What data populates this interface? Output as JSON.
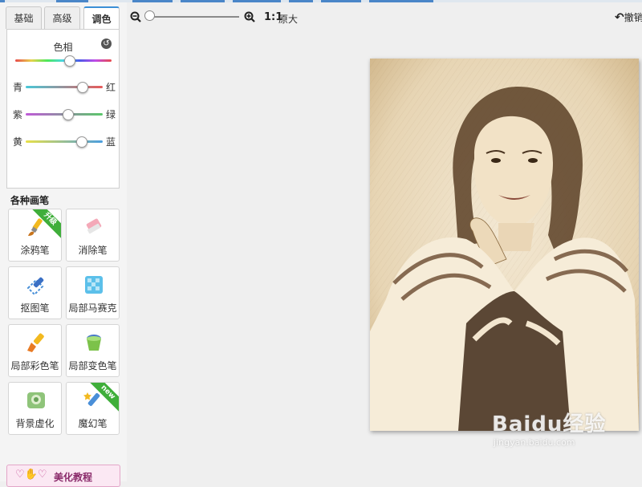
{
  "tabs": [
    {
      "label": "基础"
    },
    {
      "label": "高级"
    },
    {
      "label": "调色",
      "active": true
    }
  ],
  "color_panel": {
    "hue_label": "色相",
    "hue_level": 0.56,
    "sliders": [
      {
        "left": "青",
        "right": "红",
        "level": 0.73
      },
      {
        "left": "紫",
        "right": "绿",
        "level": 0.54
      },
      {
        "left": "黄",
        "right": "蓝",
        "level": 0.72
      }
    ]
  },
  "brushes": {
    "title": "各种画笔",
    "items": [
      {
        "label": "涂鸦笔",
        "icon": "paintbrush-icon",
        "badge": "升级"
      },
      {
        "label": "消除笔",
        "icon": "eraser-icon"
      },
      {
        "label": "抠图笔",
        "icon": "cutout-pen-icon"
      },
      {
        "label": "局部马赛克",
        "icon": "mosaic-icon"
      },
      {
        "label": "局部彩色笔",
        "icon": "color-brush-icon"
      },
      {
        "label": "局部变色笔",
        "icon": "paint-bucket-icon"
      },
      {
        "label": "背景虚化",
        "icon": "blur-background-icon"
      },
      {
        "label": "魔幻笔",
        "icon": "magic-pen-icon",
        "badge": "new"
      }
    ]
  },
  "tutorial": {
    "label": "美化教程"
  },
  "zoom": {
    "level": 0.0,
    "ratio_label": "1:1",
    "original_label": "原大"
  },
  "undo": {
    "label": "撤销"
  },
  "watermark": {
    "brand": "Baidu经验",
    "url": "jingyan.baidu.com"
  },
  "colors": {
    "accent": "#3b8fd6",
    "badge_green": "#3fae3a",
    "tutorial_pink": "#fbe8f3",
    "sepia": "#d9c4a0"
  }
}
